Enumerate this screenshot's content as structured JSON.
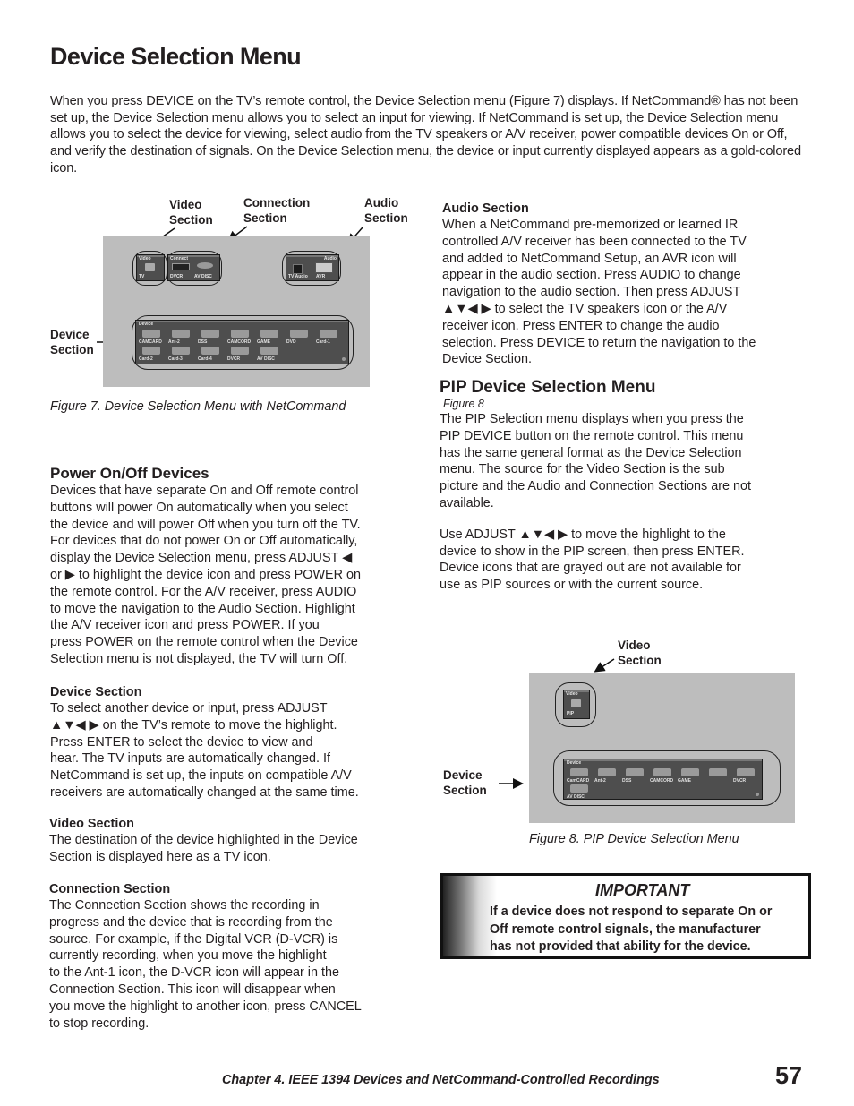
{
  "page": {
    "title": "Device Selection Menu",
    "intro": "When you press DEVICE on the TV’s remote control, the Device Selection menu (Figure 7) displays.  If NetCommand® has not been set up, the Device Selection menu allows you to select an input for viewing.  If NetCommand is set up, the Device Selection menu allows you to select the device for viewing, select audio from the TV speakers or A/V receiver, power compatible devices On or Off, and verify the destination of signals. On the Device Selection menu, the device or input currently displayed appears as a gold-colored icon."
  },
  "figure7": {
    "callouts": {
      "video_section": [
        "Video",
        "Section"
      ],
      "connection_section": [
        "Connection",
        "Section"
      ],
      "audio_section": [
        "Audio",
        "Section"
      ],
      "device_section": [
        "Device",
        "Section"
      ]
    },
    "video_box": {
      "title": "Video",
      "item": "TV"
    },
    "connect_box": {
      "title": "Connect",
      "items": [
        "DVCR",
        "AV DISC"
      ]
    },
    "audio_box": {
      "title": "Audio",
      "items": [
        "TV Audio",
        "AVR"
      ]
    },
    "device_box": {
      "title": "Device",
      "row1": [
        "CAMCARD",
        "Ant-2",
        "DSS",
        "CAMCORD",
        "GAME",
        "DVD",
        "Card-1"
      ],
      "row2": [
        "Card-2",
        "Card-3",
        "Card-4",
        "DVCR",
        "AV DISC"
      ]
    },
    "caption": "Figure 7. Device Selection Menu with NetCommand"
  },
  "audio_section": {
    "heading": "Audio Section",
    "lines": [
      "When a NetCommand pre-memorized or learned IR",
      "controlled A/V receiver has been connected to the TV",
      "and added to NetCommand Setup, an AVR icon will",
      "appear in the audio section.  Press AUDIO  to change",
      "navigation to the audio section.  Then press ADJUST",
      "▲▼◀ ▶ to select the TV speakers icon or the A/V",
      "receiver icon.  Press ENTER to change the audio",
      "selection.  Press DEVICE to return the navigation to the",
      "Device Section."
    ]
  },
  "pip_section": {
    "heading": "PIP Device Selection Menu",
    "figure_ref": "Figure 8",
    "para1": [
      "The PIP Selection menu displays when you press the",
      "PIP DEVICE button on the remote control.  This menu",
      "has the same general format as the Device Selection",
      "menu.  The source for the Video Section is the sub",
      "picture and the Audio and Connection Sections are not",
      "available."
    ],
    "para2": [
      "Use ADJUST ▲▼◀ ▶ to move the highlight to the",
      "device to show in the PIP screen, then press ENTER.",
      "Device icons that are grayed out are not available for",
      "use as PIP sources or with the current source."
    ]
  },
  "figure8": {
    "callouts": {
      "video_section": [
        "Video",
        "Section"
      ],
      "device_section": [
        "Device",
        "Section"
      ]
    },
    "video_box": {
      "title": "Video",
      "item": "PIP"
    },
    "device_box": {
      "title": "Device",
      "row1": [
        "CamCARD",
        "Ant-2",
        "DSS",
        "CAMCORD",
        "GAME",
        "",
        "DVCR"
      ],
      "row2": [
        "AV DISC"
      ]
    },
    "caption": "Figure 8. PIP Device Selection Menu"
  },
  "power_section": {
    "heading": "Power On/Off Devices",
    "lines": [
      "Devices that have separate On and Off remote control",
      "buttons will power On automatically when you select",
      "the device and will power Off when you turn off the TV.",
      "For devices that do not power On or Off automatically,",
      "display the Device Selection menu, press ADJUST ◀",
      "or ▶ to highlight the device icon and press POWER on",
      "the remote control.  For the A/V receiver, press AUDIO",
      "to move the navigation to the Audio Section.  Highlight",
      "the A/V receiver icon and press POWER.  If you",
      "press POWER on the remote control when the Device",
      "Selection menu is not displayed, the TV will turn Off."
    ]
  },
  "device_section": {
    "heading": "Device Section",
    "lines": [
      "To select another device or input, press ADJUST",
      "▲▼◀ ▶ on the TV’s remote to move the highlight.",
      "Press ENTER to select the device to view and",
      "hear.  The TV inputs are automatically changed.  If",
      "NetCommand is set up, the inputs on compatible A/V",
      "receivers are automatically changed at the same time."
    ]
  },
  "video_section": {
    "heading": "Video Section",
    "lines": [
      "The destination of the device highlighted in the Device",
      "Section is displayed here as a TV icon."
    ]
  },
  "connection_section": {
    "heading": "Connection Section",
    "lines": [
      "The Connection Section shows the recording in",
      "progress and the device that is recording from the",
      "source.  For example, if the Digital VCR (D-VCR) is",
      "currently recording, when you move the highlight",
      "to the Ant-1 icon, the D-VCR icon will appear in the",
      "Connection Section.  This icon will disappear when",
      "you move the highlight to another icon, press CANCEL",
      "to stop recording."
    ]
  },
  "important": {
    "title": "IMPORTANT",
    "lines": [
      "If a device does not respond to separate On or",
      "Off remote control signals, the manufacturer",
      "has not provided that ability for the device."
    ]
  },
  "footer": {
    "chapter": "Chapter 4. IEEE 1394 Devices and NetCommand-Controlled Recordings",
    "page_number": "57"
  }
}
